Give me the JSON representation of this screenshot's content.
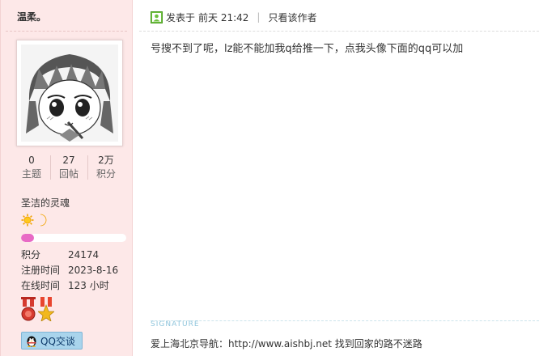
{
  "user": {
    "name": "温柔。",
    "stats": [
      {
        "value": "0",
        "label": "主题"
      },
      {
        "value": "27",
        "label": "回帖"
      },
      {
        "value": "2万",
        "label": "积分"
      }
    ],
    "group": "圣洁的灵魂",
    "level_icons": [
      "sun-icon",
      "moon-icon"
    ],
    "progress_fraction": 0.12,
    "info": [
      {
        "key": "积分",
        "value": "24174"
      },
      {
        "key": "注册时间",
        "value": "2023-8-16"
      },
      {
        "key": "在线时间",
        "value": "123 小时"
      }
    ],
    "medals": [
      "medal-red-icon",
      "medal-gold-icon"
    ],
    "qq_button": "QQ交谈"
  },
  "post": {
    "posted_label": "发表于",
    "posted_time": "前天 21:42",
    "separator": "|",
    "author_only": "只看该作者",
    "body": "号搜不到了呢，lz能不能加我q给推一下，点我头像下面的qq可以加",
    "signature_label": "SIGNATURE",
    "signature": "爱上海北京导航：http://www.aishbj.net 找到回家的路不迷路"
  },
  "colors": {
    "sidebar_bg": "#fde8e8",
    "progress": "#e86ac5",
    "qq_button": "#a9d4ec",
    "signature_label": "#8fc5dc"
  }
}
